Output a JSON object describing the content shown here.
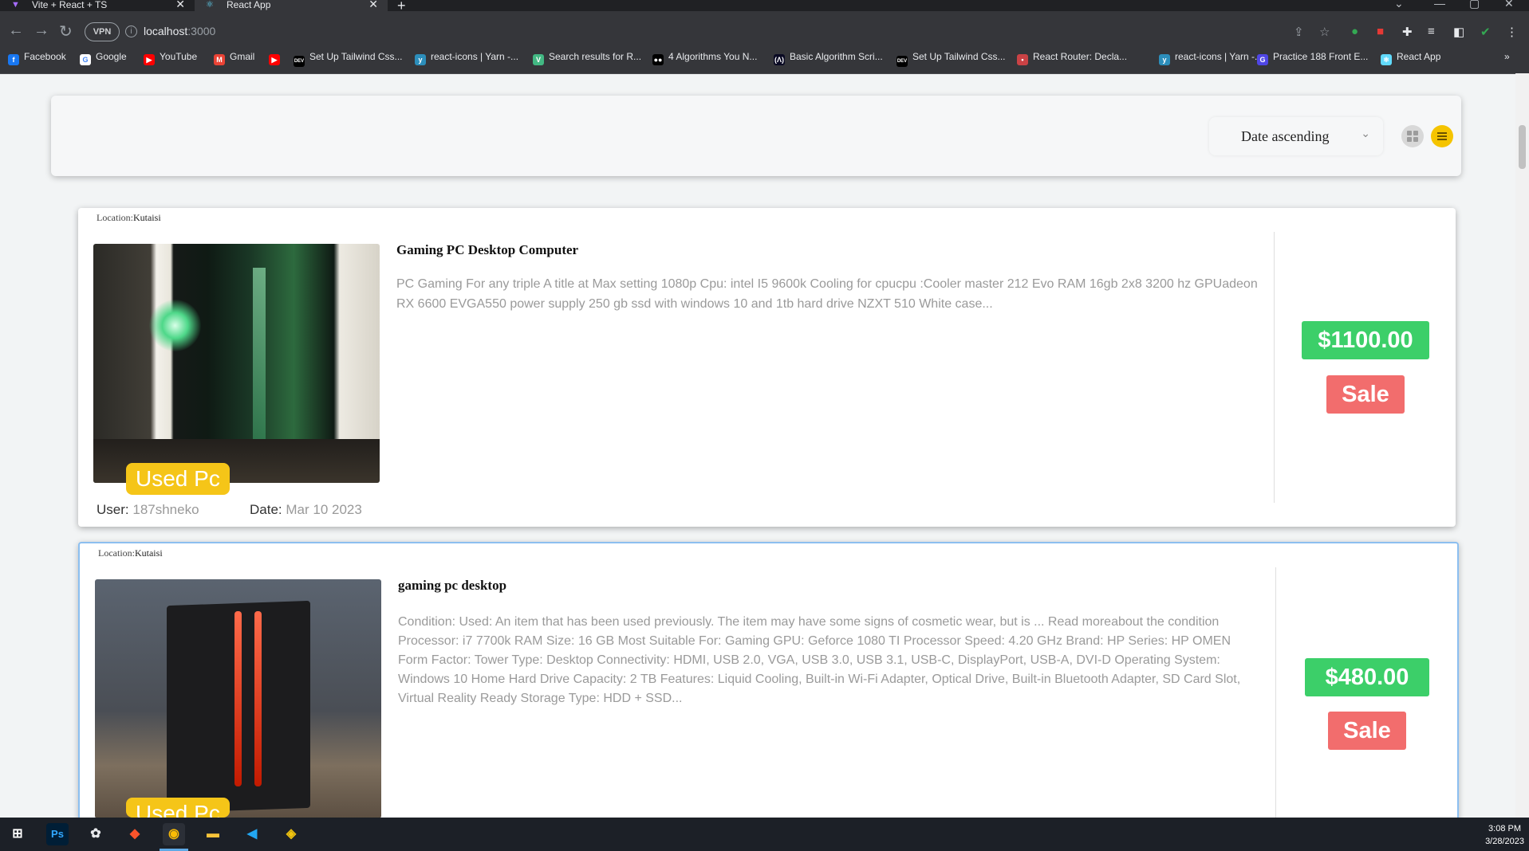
{
  "browser": {
    "tabs": [
      {
        "title": "Vite + React + TS",
        "icon": "vite-icon",
        "active": false
      },
      {
        "title": "React App",
        "icon": "react-icon",
        "active": true
      }
    ],
    "new_tab_symbol": "+",
    "close_symbol": "✕",
    "address": {
      "host": "localhost",
      "port": ":3000"
    },
    "vpn_label": "VPN",
    "bookmarks": [
      {
        "label": "Facebook",
        "icon": "facebook-icon",
        "color": "#1877f2",
        "glyph": "f"
      },
      {
        "label": "Google",
        "icon": "google-icon",
        "color": "#ffffff",
        "glyph": "G"
      },
      {
        "label": "YouTube",
        "icon": "youtube-icon",
        "color": "#ff0000",
        "glyph": "▶"
      },
      {
        "label": "Gmail",
        "icon": "gmail-icon",
        "color": "#ea4335",
        "glyph": "M"
      },
      {
        "label": "",
        "icon": "youtube-icon",
        "color": "#ff0000",
        "glyph": "▶"
      },
      {
        "label": "Set Up Tailwind Css...",
        "icon": "dev-icon",
        "color": "#000000",
        "glyph": "DEV"
      },
      {
        "label": "react-icons | Yarn -...",
        "icon": "yarn-icon",
        "color": "#2c8ebb",
        "glyph": "y"
      },
      {
        "label": "Search results for R...",
        "icon": "vue-icon",
        "color": "#42b883",
        "glyph": "V"
      },
      {
        "label": "4 Algorithms You N...",
        "icon": "medium-icon",
        "color": "#000000",
        "glyph": "●●"
      },
      {
        "label": "Basic Algorithm Scri...",
        "icon": "freecodecamp-icon",
        "color": "#0a0a23",
        "glyph": "(Λ)"
      },
      {
        "label": "Set Up Tailwind Css...",
        "icon": "dev-icon",
        "color": "#000000",
        "glyph": "DEV"
      },
      {
        "label": "React Router: Decla...",
        "icon": "react-router-icon",
        "color": "#ca4245",
        "glyph": "•"
      },
      {
        "label": "react-icons | Yarn -...",
        "icon": "yarn-icon",
        "color": "#2c8ebb",
        "glyph": "y"
      },
      {
        "label": "Practice 188 Front E...",
        "icon": "greatfrontend-icon",
        "color": "#4f46e5",
        "glyph": "G"
      },
      {
        "label": "React App",
        "icon": "react-icon",
        "color": "#61dafb",
        "glyph": "⚛"
      }
    ],
    "more_bookmarks": "»"
  },
  "toolbar": {
    "sort_label": "Date ascending",
    "chevron": "⌄"
  },
  "listings": [
    {
      "location_label": "Location:",
      "location": "Kutaisi",
      "title": "Gaming PC Desktop Computer",
      "description": "PC Gaming For any triple A title at Max setting 1080p Cpu: intel I5 9600k Cooling for cpucpu :Cooler master 212 Evo RAM 16gb 2x8 3200 hz GPUadeon RX 6600 EVGA550 power supply 250 gb ssd with windows 10 and 1tb hard drive NZXT 510 White case...",
      "category": "Used Pc",
      "user_label": "User:",
      "user": "187shneko",
      "date_label": "Date:",
      "date": "Mar 10 2023",
      "price": "$1100.00",
      "sale_label": "Sale"
    },
    {
      "location_label": "Location:",
      "location": "Kutaisi",
      "title": "gaming pc desktop",
      "description": "Condition: Used: An item that has been used previously. The item may have some signs of cosmetic wear, but is ... Read moreabout the condition Processor: i7 7700k RAM Size: 16 GB Most Suitable For: Gaming GPU: Geforce 1080 TI Processor Speed: 4.20 GHz Brand: HP Series: HP OMEN Form Factor: Tower Type: Desktop Connectivity: HDMI, USB 2.0, VGA, USB 3.0, USB 3.1, USB-C, DisplayPort, USB-A, DVI-D Operating System: Windows 10 Home Hard Drive Capacity: 2 TB Features: Liquid Cooling, Built-in Wi-Fi Adapter, Optical Drive, Built-in Bluetooth Adapter, SD Card Slot, Virtual Reality Ready Storage Type: HDD + SSD...",
      "category": "Used Pc",
      "price": "$480.00",
      "sale_label": "Sale"
    }
  ],
  "taskbar": {
    "apps": [
      "windows-start-icon",
      "photoshop-icon",
      "paint-icon",
      "brave-icon",
      "chrome-icon",
      "file-explorer-icon",
      "vscode-icon",
      "git-icon"
    ],
    "time": "3:08 PM",
    "date": "3/28/2023"
  },
  "colors": {
    "accent_yellow": "#f5c518",
    "price_green": "#3ccf69",
    "sale_red": "#f26d6d"
  }
}
